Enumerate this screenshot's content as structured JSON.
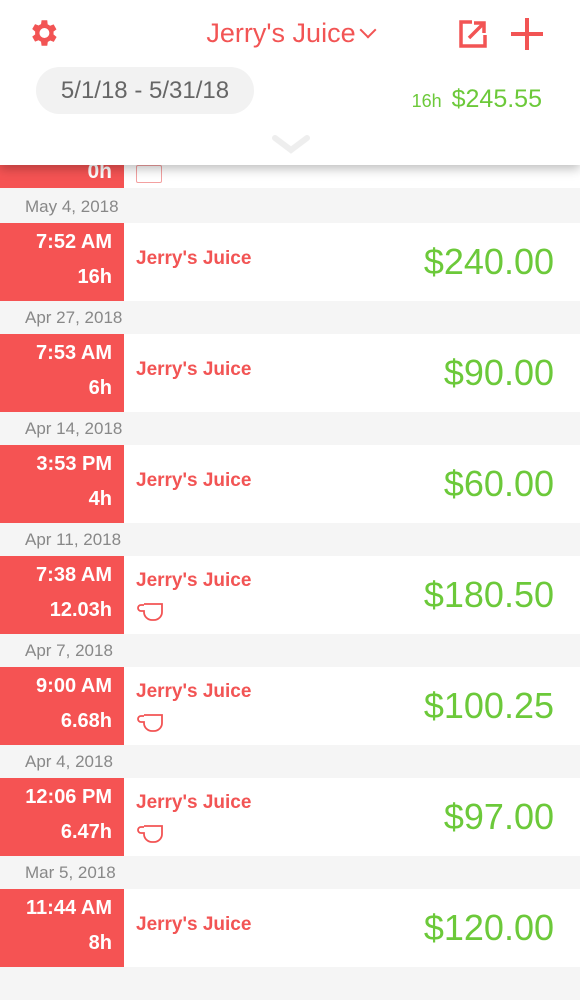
{
  "header": {
    "title": "Jerry's Juice",
    "date_range": "5/1/18 - 5/31/18",
    "total_hours": "16h",
    "total_amount": "$245.55",
    "icons": {
      "settings": "gear-icon",
      "dropdown": "chevron-down-icon",
      "export": "export-icon",
      "add": "plus-icon",
      "pull": "chevron-down-icon"
    }
  },
  "partial_entry": {
    "duration": "0h",
    "icon": "camera-icon"
  },
  "entries": [
    {
      "date": "May 4, 2018",
      "time": "7:52 AM",
      "duration": "16h",
      "client": "Jerry's Juice",
      "amount": "$240.00",
      "has_cup": false
    },
    {
      "date": "Apr 27, 2018",
      "time": "7:53 AM",
      "duration": "6h",
      "client": "Jerry's Juice",
      "amount": "$90.00",
      "has_cup": false
    },
    {
      "date": "Apr 14, 2018",
      "time": "3:53 PM",
      "duration": "4h",
      "client": "Jerry's Juice",
      "amount": "$60.00",
      "has_cup": false
    },
    {
      "date": "Apr 11, 2018",
      "time": "7:38 AM",
      "duration": "12.03h",
      "client": "Jerry's Juice",
      "amount": "$180.50",
      "has_cup": true
    },
    {
      "date": "Apr 7, 2018",
      "time": "9:00 AM",
      "duration": "6.68h",
      "client": "Jerry's Juice",
      "amount": "$100.25",
      "has_cup": true
    },
    {
      "date": "Apr 4, 2018",
      "time": "12:06 PM",
      "duration": "6.47h",
      "client": "Jerry's Juice",
      "amount": "$97.00",
      "has_cup": true
    },
    {
      "date": "Mar 5, 2018",
      "time": "11:44 AM",
      "duration": "8h",
      "client": "Jerry's Juice",
      "amount": "$120.00",
      "has_cup": false
    }
  ]
}
